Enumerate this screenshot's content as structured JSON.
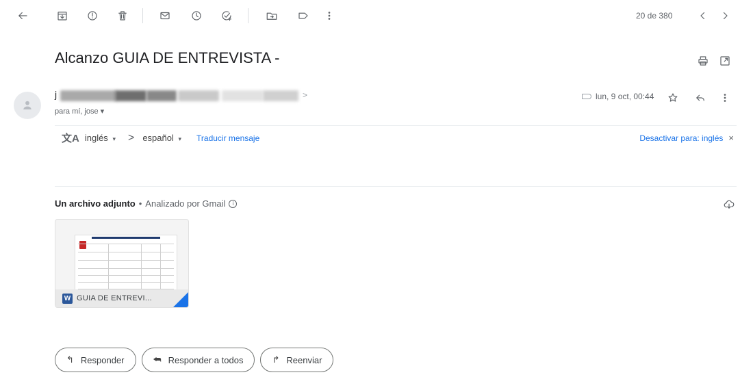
{
  "toolbar": {
    "counter": "20 de 380"
  },
  "message": {
    "subject": "Alcanzo GUIA DE ENTREVISTA -",
    "sender_initial": "j",
    "sender_chevron": ">",
    "recipients": "para mí, jose ▾",
    "date": "lun, 9 oct, 00:44"
  },
  "translate": {
    "icon": "文A",
    "from_lang": "inglés",
    "caret": "▾",
    "arrow": ">",
    "to_lang": "español",
    "translate_link": "Traducir mensaje",
    "disable_link": "Desactivar para: inglés",
    "close": "×"
  },
  "attachments": {
    "title": "Un archivo adjunto",
    "dot": "•",
    "scanned": "Analizado por Gmail",
    "info": "i",
    "file_badge": "W",
    "file_name": "GUIA DE ENTREVI..."
  },
  "actions": {
    "reply_icon": "↰",
    "reply": "Responder",
    "reply_all_icon": "⮪",
    "reply_all": "Responder a todos",
    "forward_icon": "↱",
    "forward": "Reenviar"
  },
  "icons": {
    "back": "arrow-left-icon",
    "archive": "archive-icon",
    "spam": "report-spam-icon",
    "delete": "trash-icon",
    "unread": "mark-unread-icon",
    "snooze": "clock-icon",
    "task": "add-task-icon",
    "move": "move-to-folder-icon",
    "label": "label-icon",
    "more": "more-vert-icon",
    "prev": "chevron-left-icon",
    "next": "chevron-right-icon",
    "print": "print-icon",
    "popout": "open-new-window-icon",
    "star": "star-icon",
    "reply": "reply-icon",
    "download": "download-all-icon"
  },
  "colors": {
    "link": "#1a73e8",
    "word": "#2b579a",
    "text": "#202124",
    "muted": "#5f6368"
  }
}
